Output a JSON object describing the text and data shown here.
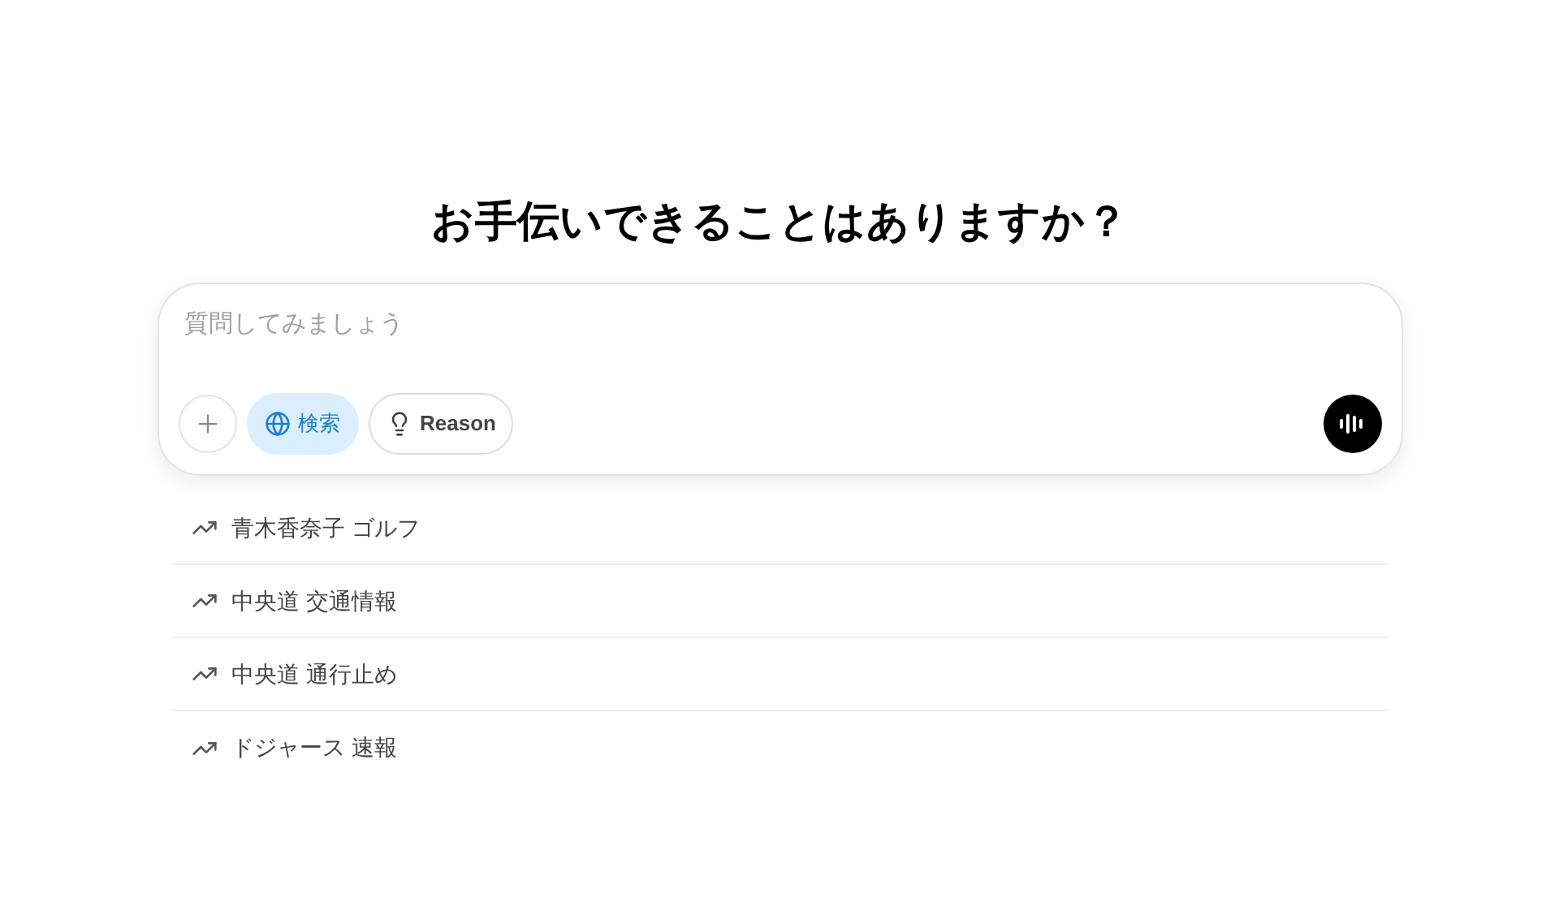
{
  "heading": "お手伝いできることはありますか？",
  "composer": {
    "placeholder": "質問してみましょう",
    "tools": [
      {
        "kind": "search",
        "label": "検索",
        "selected": true
      },
      {
        "kind": "reason",
        "label": "Reason",
        "selected": false
      }
    ]
  },
  "suggestions": [
    {
      "text": "青木香奈子 ゴルフ"
    },
    {
      "text": "中央道 交通情報"
    },
    {
      "text": "中央道 通行止め"
    },
    {
      "text": "ドジャース 速報"
    }
  ]
}
